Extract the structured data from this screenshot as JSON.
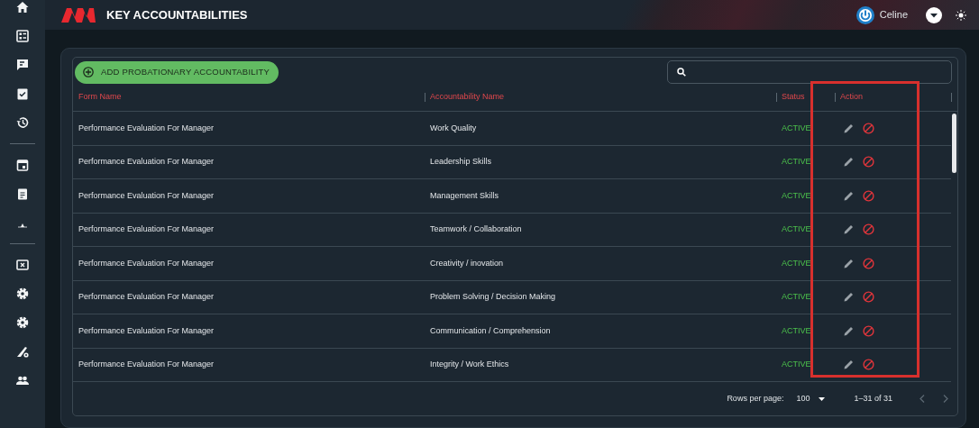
{
  "header": {
    "title": "KEY ACCOUNTABILITIES",
    "user_name": "Celine"
  },
  "toolbar": {
    "add_button": "ADD PROBATIONARY ACCOUNTABILITY"
  },
  "table": {
    "columns": [
      "Form Name",
      "Accountability Name",
      "Status",
      "Action"
    ],
    "rows": [
      {
        "form_name": "Performance Evaluation For Manager",
        "accountability_name": "Work Quality",
        "status": "ACTIVE"
      },
      {
        "form_name": "Performance Evaluation For Manager",
        "accountability_name": "Leadership Skills",
        "status": "ACTIVE"
      },
      {
        "form_name": "Performance Evaluation For Manager",
        "accountability_name": "Management Skills",
        "status": "ACTIVE"
      },
      {
        "form_name": "Performance Evaluation For Manager",
        "accountability_name": "Teamwork / Collaboration",
        "status": "ACTIVE"
      },
      {
        "form_name": "Performance Evaluation For Manager",
        "accountability_name": "Creativity / inovation",
        "status": "ACTIVE"
      },
      {
        "form_name": "Performance Evaluation For Manager",
        "accountability_name": "Problem Solving / Decision Making",
        "status": "ACTIVE"
      },
      {
        "form_name": "Performance Evaluation For Manager",
        "accountability_name": "Communication / Comprehension",
        "status": "ACTIVE"
      },
      {
        "form_name": "Performance Evaluation For Manager",
        "accountability_name": "Integrity / Work Ethics",
        "status": "ACTIVE"
      }
    ]
  },
  "pagination": {
    "rows_per_page_label": "Rows per page:",
    "rows_per_page": "100",
    "range": "1–31 of 31"
  }
}
